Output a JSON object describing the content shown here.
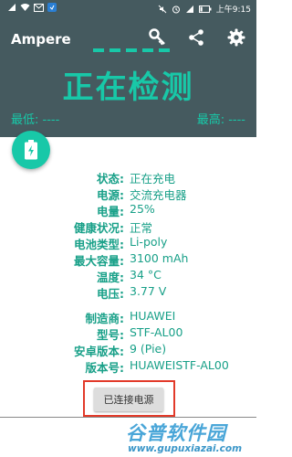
{
  "status_bar": {
    "time": "上午9:15",
    "battery_level": 0.25,
    "left_icons": [
      "signal-icon",
      "wifi-icon",
      "mail-icon",
      "app-notification-icon"
    ],
    "right_icons": [
      "mute-icon",
      "alarm-icon",
      "signal-bars-icon",
      "battery-icon"
    ]
  },
  "toolbar": {
    "title": "Ampere",
    "icons": [
      "key-icon",
      "share-icon",
      "settings-icon"
    ]
  },
  "header": {
    "big_status": "正在检测",
    "min_label": "最低: ----",
    "max_label": "最高: ----"
  },
  "fab": {
    "icon": "battery-charging-icon"
  },
  "battery_info": [
    {
      "label": "状态:",
      "value": "正在充电"
    },
    {
      "label": "电源:",
      "value": "交流充电器"
    },
    {
      "label": "电量:",
      "value": "25%"
    },
    {
      "label": "健康状况:",
      "value": "正常"
    },
    {
      "label": "电池类型:",
      "value": "Li-poly"
    },
    {
      "label": "最大容量:",
      "value": "3100 mAh"
    },
    {
      "label": "温度:",
      "value": "34 °C"
    },
    {
      "label": "电压:",
      "value": "3.77 V"
    }
  ],
  "device_info": [
    {
      "label": "制造商:",
      "value": "HUAWEI"
    },
    {
      "label": "型号:",
      "value": "STF-AL00"
    },
    {
      "label": "安卓版本:",
      "value": "9 (Pie)"
    },
    {
      "label": "版本号:",
      "value": "HUAWEISTF-AL00"
    }
  ],
  "connect_button": "已连接电源",
  "watermark": {
    "main": "谷普软件园",
    "url": "www.gupuxiazai.com"
  },
  "colors": {
    "header_bg": "#455a5f",
    "accent": "#18c8a8",
    "text_accent": "#18a088",
    "highlight": "#e23a2a"
  }
}
